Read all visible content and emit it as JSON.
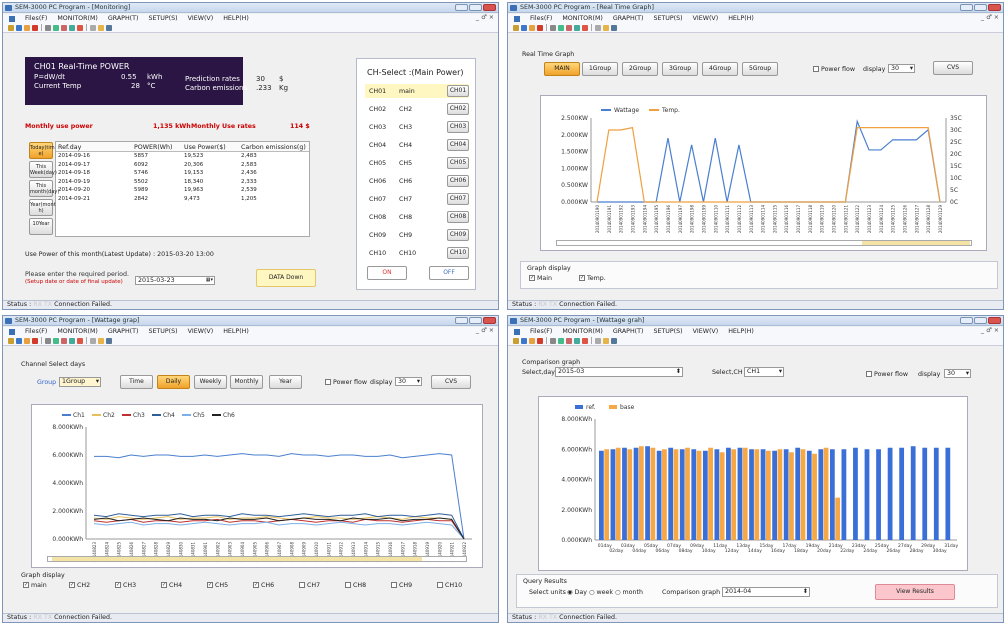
{
  "app_title": "SEM-3000 PC Program",
  "menu": [
    "Files(F)",
    "MONITOR(M)",
    "GRAPH(T)",
    "SETUP(S)",
    "VIEW(V)",
    "HELP(H)"
  ],
  "menu_close": "_ ♂ ×",
  "status": {
    "label": "Status :",
    "rx": "RX",
    "tx": "TX",
    "msg": "Connection Failed."
  },
  "toolbar_colors": [
    "#c9a030",
    "#3d78c8",
    "#e8a040",
    "#d23a2a",
    "#888",
    "#4b8",
    "#c66",
    "#4a9",
    "#d54",
    "#aaa",
    "#e7b44a",
    "#579"
  ],
  "w1": {
    "title": "SEM-3000 PC Program - [Monitoring]",
    "power_title": "CH01  Real-Time POWER",
    "pdwdt_label": "P=dW/dt",
    "pdwdt_value": "0.55",
    "pdwdt_unit": "kWh",
    "temp_label": "Current Temp",
    "temp_value": "28",
    "temp_unit": "°C",
    "pred_label": "Prediction rates",
    "pred_value": "30",
    "pred_unit": "$",
    "carbon_label": "Carbon emissions",
    "carbon_value": ".233",
    "carbon_unit": "Kg",
    "monthly_label": "Monthly use power",
    "monthly_value": "1,135 kWh",
    "monthly_rates_label": "Monthly Use rates",
    "monthly_rates_value": "114 $",
    "side_buttons": [
      "Today(tim e)",
      "This Week(day)",
      "This month(day)",
      "Year(mont h)",
      "10Year"
    ],
    "table_headers": [
      "Ref.day",
      "POWER(Wh)",
      "Use Power($)",
      "Carbon emissions(g)"
    ],
    "rows": [
      [
        "2014-09-16",
        "5857",
        "19,523",
        "2,483"
      ],
      [
        "2014-09-17",
        "6092",
        "20,306",
        "2,583"
      ],
      [
        "2014-09-18",
        "5746",
        "19,153",
        "2,436"
      ],
      [
        "2014-09-19",
        "5502",
        "18,340",
        "2,333"
      ],
      [
        "2014-09-20",
        "5989",
        "19,963",
        "2,539"
      ],
      [
        "2014-09-21",
        "2842",
        "9,473",
        "1,205"
      ]
    ],
    "latest": "Use Power of this month(Latest Update) :  2015-03-20 13:00",
    "period_prompt": "Please enter the required period.",
    "period_hint": "(Setup date or date of final update)",
    "period_value": "2015-03-23",
    "data_down": "DATA Down",
    "ch_select": "CH-Select :(Main Power)",
    "channels": [
      [
        "CH01",
        "main",
        "CH01"
      ],
      [
        "CH02",
        "CH2",
        "CH02"
      ],
      [
        "CH03",
        "CH3",
        "CH03"
      ],
      [
        "CH04",
        "CH4",
        "CH04"
      ],
      [
        "CH05",
        "CH5",
        "CH05"
      ],
      [
        "CH06",
        "CH6",
        "CH06"
      ],
      [
        "CH07",
        "CH7",
        "CH07"
      ],
      [
        "CH08",
        "CH8",
        "CH08"
      ],
      [
        "CH09",
        "CH9",
        "CH09"
      ],
      [
        "CH10",
        "CH10",
        "CH10"
      ]
    ],
    "on": "ON",
    "off": "OFF"
  },
  "w2": {
    "title": "SEM-3000 PC Program - [Real Time Graph]",
    "group_label": "Real Time Graph",
    "buttons": [
      "MAIN",
      "1Group",
      "2Group",
      "3Group",
      "4Group",
      "5Group"
    ],
    "power_flow": "Power flow",
    "display": "display",
    "display_value": "30",
    "cvs": "CVS",
    "graph_display": "Graph display",
    "chk_main": "Main",
    "chk_temp": "Temp.",
    "chart_data": {
      "type": "line",
      "legend": [
        "Wattage",
        "Temp."
      ],
      "x": [
        "20140901190",
        "20140901191",
        "20140901192",
        "20140901193",
        "20140901194",
        "20140901195",
        "20140901196",
        "20140901197",
        "20140901198",
        "20140901199",
        "20140901110",
        "20140901111",
        "20140901112",
        "20140901113",
        "20140901114",
        "20140901115",
        "20140901116",
        "20140901117",
        "20140901118",
        "20140901119",
        "20140901120",
        "20140901121",
        "20140901122",
        "20140901123",
        "20140901124",
        "20140901125",
        "20140901126",
        "20140901127",
        "20140901128",
        "20140901129"
      ],
      "series": [
        {
          "name": "Wattage",
          "values": [
            0,
            0,
            0,
            0,
            0,
            0,
            1900,
            0,
            1700,
            0,
            1900,
            0,
            1700,
            0,
            0,
            0,
            0,
            0,
            0,
            0,
            0,
            0,
            2400,
            1550,
            1550,
            1850,
            1850,
            1850,
            2150,
            0
          ]
        },
        {
          "name": "Temp.",
          "values": [
            0,
            30,
            30,
            31,
            0,
            0,
            0,
            0,
            0,
            0,
            0,
            0,
            0,
            0,
            0,
            0,
            0,
            0,
            0,
            0,
            0,
            0,
            31,
            31,
            31,
            31,
            31,
            31,
            31,
            0
          ]
        }
      ],
      "ylim_left": [
        0,
        2500
      ],
      "ylim_right": [
        0,
        35
      ],
      "yticks_left": [
        "2.500KW",
        "2.000KW",
        "1.500KW",
        "1.000KW",
        "0.500KW",
        "0.000KW"
      ],
      "yticks_right": [
        "35C",
        "30C",
        "25C",
        "20C",
        "15C",
        "10C",
        "5C",
        "0C"
      ]
    }
  },
  "w3": {
    "title": "SEM-3000 PC Program - [Wattage grap]",
    "group_label": "Channel Select days",
    "group": "Group",
    "group_value": "1Group",
    "buttons": [
      "Time",
      "Daily",
      "Weekly",
      "Monthly",
      "Year"
    ],
    "power_flow": "Power flow",
    "display": "display",
    "display_value": "30",
    "cvs": "CVS",
    "graph_display": "Graph display",
    "checks": [
      [
        "main",
        true
      ],
      [
        "CH2",
        true
      ],
      [
        "CH3",
        true
      ],
      [
        "CH4",
        true
      ],
      [
        "CH5",
        true
      ],
      [
        "CH6",
        true
      ],
      [
        "CH7",
        false
      ],
      [
        "CH8",
        false
      ],
      [
        "CH9",
        false
      ],
      [
        "CH10",
        false
      ]
    ],
    "chart_data": {
      "type": "line",
      "legend": [
        "Ch1",
        "Ch2",
        "Ch3",
        "Ch4",
        "Ch5",
        "Ch6"
      ],
      "x": [
        "20140823",
        "20140824",
        "20140825",
        "20140826",
        "20140827",
        "20140828",
        "20140829",
        "20140830",
        "20140831",
        "20140901",
        "20140902",
        "20140903",
        "20140904",
        "20140905",
        "20140906",
        "20140907",
        "20140908",
        "20140909",
        "20140910",
        "20140911",
        "20140912",
        "20140913",
        "20140914",
        "20140915",
        "20140916",
        "20140917",
        "20140918",
        "20140919",
        "20140920",
        "20140921",
        "20140922"
      ],
      "series": [
        {
          "name": "Ch1",
          "values": [
            5900,
            5900,
            5800,
            6000,
            5900,
            6000,
            6000,
            5900,
            5900,
            6000,
            5900,
            6000,
            6100,
            6000,
            6000,
            5900,
            6100,
            6000,
            6000,
            5900,
            6000,
            6000,
            5900,
            5900,
            6000,
            5800,
            5900,
            6000,
            6100,
            6000,
            0
          ]
        },
        {
          "name": "Ch2",
          "values": [
            1500,
            1400,
            1600,
            1500,
            1400,
            1500,
            1600,
            1400,
            1500,
            1500,
            1600,
            1400,
            1500,
            1500,
            1600,
            1500,
            1400,
            1500,
            1600,
            1500,
            1500,
            1400,
            1500,
            1600,
            1500,
            1400,
            1600,
            1500,
            1500,
            1400,
            0
          ]
        },
        {
          "name": "Ch3",
          "values": [
            1300,
            1200,
            1300,
            1400,
            1200,
            1300,
            1300,
            1200,
            1300,
            1300,
            1400,
            1200,
            1300,
            1300,
            1200,
            1300,
            1400,
            1300,
            1200,
            1300,
            1300,
            1200,
            1400,
            1300,
            1300,
            1200,
            1300,
            1400,
            1300,
            1300,
            0
          ]
        },
        {
          "name": "Ch4",
          "values": [
            1700,
            1600,
            1800,
            1700,
            1600,
            1700,
            1700,
            1800,
            1600,
            1700,
            1700,
            1600,
            1800,
            1700,
            1700,
            1600,
            1700,
            1800,
            1700,
            1600,
            1700,
            1700,
            1800,
            1600,
            1700,
            1700,
            1600,
            1700,
            1800,
            1700,
            0
          ]
        },
        {
          "name": "Ch5",
          "values": [
            1100,
            1000,
            1100,
            1200,
            1000,
            1100,
            1100,
            1000,
            1100,
            1200,
            1100,
            1000,
            1100,
            1100,
            1200,
            1000,
            1100,
            1100,
            1000,
            1100,
            1200,
            1100,
            1000,
            1100,
            1100,
            1000,
            1100,
            1200,
            1100,
            1000,
            0
          ]
        },
        {
          "name": "Ch6",
          "values": [
            1400,
            1500,
            1300,
            1400,
            1500,
            1400,
            1300,
            1500,
            1400,
            1400,
            1300,
            1500,
            1400,
            1400,
            1500,
            1300,
            1400,
            1500,
            1400,
            1400,
            1300,
            1500,
            1400,
            1400,
            1500,
            1300,
            1400,
            1400,
            1500,
            1400,
            0
          ]
        }
      ],
      "ylim": [
        0,
        8000
      ],
      "yticks": [
        "8.000KWh",
        "6.000KWh",
        "4.000KWh",
        "2.000KWh",
        "0.000KWh"
      ]
    }
  },
  "w4": {
    "title": "SEM-3000 PC Program - [Wattage grah]",
    "group_label": "Comparison graph",
    "select_day": "Select,day",
    "day_value": "2015-03",
    "select_ch": "Select,CH",
    "ch_value": "CH1",
    "power_flow": "Power flow",
    "display": "display",
    "display_value": "30",
    "query_label": "Query Results",
    "select_units": "Select units",
    "units": [
      "Day",
      "week",
      "month"
    ],
    "comparison": "Comparison graph",
    "comparison_value": "2014-04",
    "view_results": "View Results",
    "chart_data": {
      "type": "bar",
      "legend": [
        "ref.",
        "base"
      ],
      "categories": [
        "01day",
        "02day",
        "03day",
        "04day",
        "05day",
        "06day",
        "07day",
        "08day",
        "09day",
        "10day",
        "11day",
        "12day",
        "13day",
        "14day",
        "15day",
        "16day",
        "17day",
        "18day",
        "19day",
        "20day",
        "21day",
        "22day",
        "23day",
        "24day",
        "25day",
        "26day",
        "27day",
        "28day",
        "29day",
        "30day",
        "31day"
      ],
      "series": [
        {
          "name": "ref.",
          "values": [
            5900,
            6000,
            6100,
            6100,
            6200,
            5900,
            6100,
            6000,
            6000,
            5900,
            6000,
            6100,
            6100,
            6000,
            6000,
            5900,
            6000,
            6100,
            5900,
            6000,
            6000,
            6000,
            6100,
            6000,
            6000,
            6100,
            6100,
            6200,
            6100,
            6100,
            6100
          ]
        },
        {
          "name": "base",
          "values": [
            6000,
            6100,
            6000,
            6200,
            6100,
            6000,
            6000,
            6100,
            5900,
            6100,
            5800,
            6000,
            6100,
            6000,
            5900,
            6000,
            5800,
            6000,
            5700,
            6100,
            2800,
            null,
            null,
            null,
            null,
            null,
            null,
            null,
            null,
            null,
            null
          ]
        }
      ],
      "ylim": [
        0,
        8000
      ],
      "yticks": [
        "8.000KWh",
        "6.000KWh",
        "4.000KWh",
        "2.000KWh",
        "0.000KWh"
      ]
    }
  }
}
